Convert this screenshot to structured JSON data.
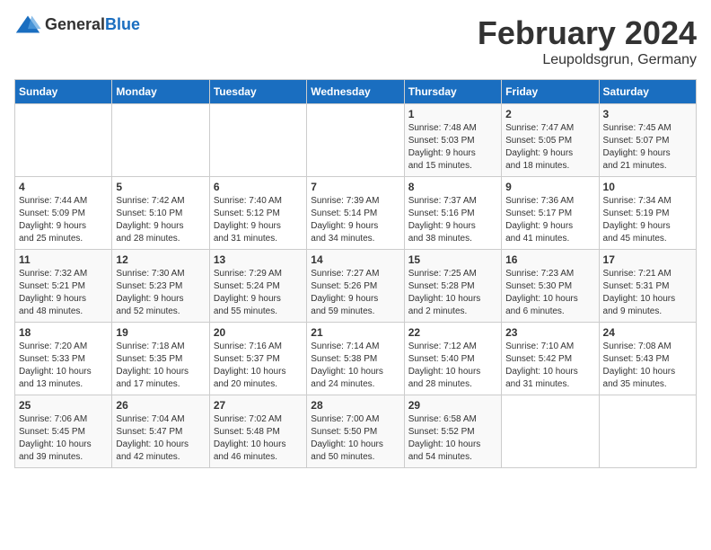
{
  "logo": {
    "general": "General",
    "blue": "Blue"
  },
  "title": "February 2024",
  "subtitle": "Leupoldsgrun, Germany",
  "headers": [
    "Sunday",
    "Monday",
    "Tuesday",
    "Wednesday",
    "Thursday",
    "Friday",
    "Saturday"
  ],
  "weeks": [
    [
      {
        "day": "",
        "info": ""
      },
      {
        "day": "",
        "info": ""
      },
      {
        "day": "",
        "info": ""
      },
      {
        "day": "",
        "info": ""
      },
      {
        "day": "1",
        "info": "Sunrise: 7:48 AM\nSunset: 5:03 PM\nDaylight: 9 hours\nand 15 minutes."
      },
      {
        "day": "2",
        "info": "Sunrise: 7:47 AM\nSunset: 5:05 PM\nDaylight: 9 hours\nand 18 minutes."
      },
      {
        "day": "3",
        "info": "Sunrise: 7:45 AM\nSunset: 5:07 PM\nDaylight: 9 hours\nand 21 minutes."
      }
    ],
    [
      {
        "day": "4",
        "info": "Sunrise: 7:44 AM\nSunset: 5:09 PM\nDaylight: 9 hours\nand 25 minutes."
      },
      {
        "day": "5",
        "info": "Sunrise: 7:42 AM\nSunset: 5:10 PM\nDaylight: 9 hours\nand 28 minutes."
      },
      {
        "day": "6",
        "info": "Sunrise: 7:40 AM\nSunset: 5:12 PM\nDaylight: 9 hours\nand 31 minutes."
      },
      {
        "day": "7",
        "info": "Sunrise: 7:39 AM\nSunset: 5:14 PM\nDaylight: 9 hours\nand 34 minutes."
      },
      {
        "day": "8",
        "info": "Sunrise: 7:37 AM\nSunset: 5:16 PM\nDaylight: 9 hours\nand 38 minutes."
      },
      {
        "day": "9",
        "info": "Sunrise: 7:36 AM\nSunset: 5:17 PM\nDaylight: 9 hours\nand 41 minutes."
      },
      {
        "day": "10",
        "info": "Sunrise: 7:34 AM\nSunset: 5:19 PM\nDaylight: 9 hours\nand 45 minutes."
      }
    ],
    [
      {
        "day": "11",
        "info": "Sunrise: 7:32 AM\nSunset: 5:21 PM\nDaylight: 9 hours\nand 48 minutes."
      },
      {
        "day": "12",
        "info": "Sunrise: 7:30 AM\nSunset: 5:23 PM\nDaylight: 9 hours\nand 52 minutes."
      },
      {
        "day": "13",
        "info": "Sunrise: 7:29 AM\nSunset: 5:24 PM\nDaylight: 9 hours\nand 55 minutes."
      },
      {
        "day": "14",
        "info": "Sunrise: 7:27 AM\nSunset: 5:26 PM\nDaylight: 9 hours\nand 59 minutes."
      },
      {
        "day": "15",
        "info": "Sunrise: 7:25 AM\nSunset: 5:28 PM\nDaylight: 10 hours\nand 2 minutes."
      },
      {
        "day": "16",
        "info": "Sunrise: 7:23 AM\nSunset: 5:30 PM\nDaylight: 10 hours\nand 6 minutes."
      },
      {
        "day": "17",
        "info": "Sunrise: 7:21 AM\nSunset: 5:31 PM\nDaylight: 10 hours\nand 9 minutes."
      }
    ],
    [
      {
        "day": "18",
        "info": "Sunrise: 7:20 AM\nSunset: 5:33 PM\nDaylight: 10 hours\nand 13 minutes."
      },
      {
        "day": "19",
        "info": "Sunrise: 7:18 AM\nSunset: 5:35 PM\nDaylight: 10 hours\nand 17 minutes."
      },
      {
        "day": "20",
        "info": "Sunrise: 7:16 AM\nSunset: 5:37 PM\nDaylight: 10 hours\nand 20 minutes."
      },
      {
        "day": "21",
        "info": "Sunrise: 7:14 AM\nSunset: 5:38 PM\nDaylight: 10 hours\nand 24 minutes."
      },
      {
        "day": "22",
        "info": "Sunrise: 7:12 AM\nSunset: 5:40 PM\nDaylight: 10 hours\nand 28 minutes."
      },
      {
        "day": "23",
        "info": "Sunrise: 7:10 AM\nSunset: 5:42 PM\nDaylight: 10 hours\nand 31 minutes."
      },
      {
        "day": "24",
        "info": "Sunrise: 7:08 AM\nSunset: 5:43 PM\nDaylight: 10 hours\nand 35 minutes."
      }
    ],
    [
      {
        "day": "25",
        "info": "Sunrise: 7:06 AM\nSunset: 5:45 PM\nDaylight: 10 hours\nand 39 minutes."
      },
      {
        "day": "26",
        "info": "Sunrise: 7:04 AM\nSunset: 5:47 PM\nDaylight: 10 hours\nand 42 minutes."
      },
      {
        "day": "27",
        "info": "Sunrise: 7:02 AM\nSunset: 5:48 PM\nDaylight: 10 hours\nand 46 minutes."
      },
      {
        "day": "28",
        "info": "Sunrise: 7:00 AM\nSunset: 5:50 PM\nDaylight: 10 hours\nand 50 minutes."
      },
      {
        "day": "29",
        "info": "Sunrise: 6:58 AM\nSunset: 5:52 PM\nDaylight: 10 hours\nand 54 minutes."
      },
      {
        "day": "",
        "info": ""
      },
      {
        "day": "",
        "info": ""
      }
    ]
  ]
}
